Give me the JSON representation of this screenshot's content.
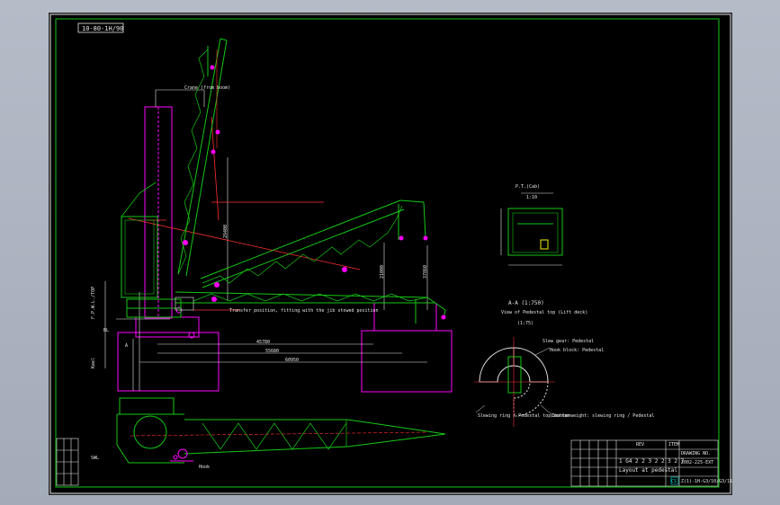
{
  "drawing_id": "10-80-1H/90",
  "main_note": "Transfer position, fitting with the jib stowed position",
  "elevation_labels": [
    "F.P.W.L./TOP",
    "Keel",
    "BL"
  ],
  "view_a": {
    "label": "A",
    "title": "A-A (1:750)",
    "subtitle": "View of Pedestal top (Lift deck)",
    "scale": "(1:75)",
    "callout_a": "Slew gear: Pedestal",
    "callout_b": "Hook block: Pedestal",
    "callout_c": "Slewing ring / Pedestal top/bottom",
    "callout_d": "Counterweight: slewing ring / Pedestal"
  },
  "view_b": {
    "title": "P.T.(Cab)",
    "scale": "1:10"
  },
  "dims": {
    "jib_length": "Crane (from boom)",
    "reach_1": "45780",
    "reach_2": "55680",
    "reach_3": "60950",
    "height_1": "29400",
    "height_2": "21000",
    "height_3": "37860"
  },
  "plan_labels": {
    "left": "SWL",
    "bottom": "Hook"
  },
  "title_block": {
    "rev_col": "REV",
    "item_col": "ITEM",
    "drawing_no_label": "DRAWING NO.",
    "project": "2002-225-EXT",
    "doc_no": "1 G4 2 2 3 2 2 3 2 7",
    "doc_title": "Layout at pedestal",
    "company": "CS",
    "file_code": "Z(1)-1H-G3/10/G3/11"
  },
  "colors": {
    "green": "#14c814",
    "magenta": "#ff00ff",
    "red": "#ff3030",
    "white": "#e8e8e8",
    "yellow": "#f0f000",
    "cyan": "#00e0e0"
  }
}
